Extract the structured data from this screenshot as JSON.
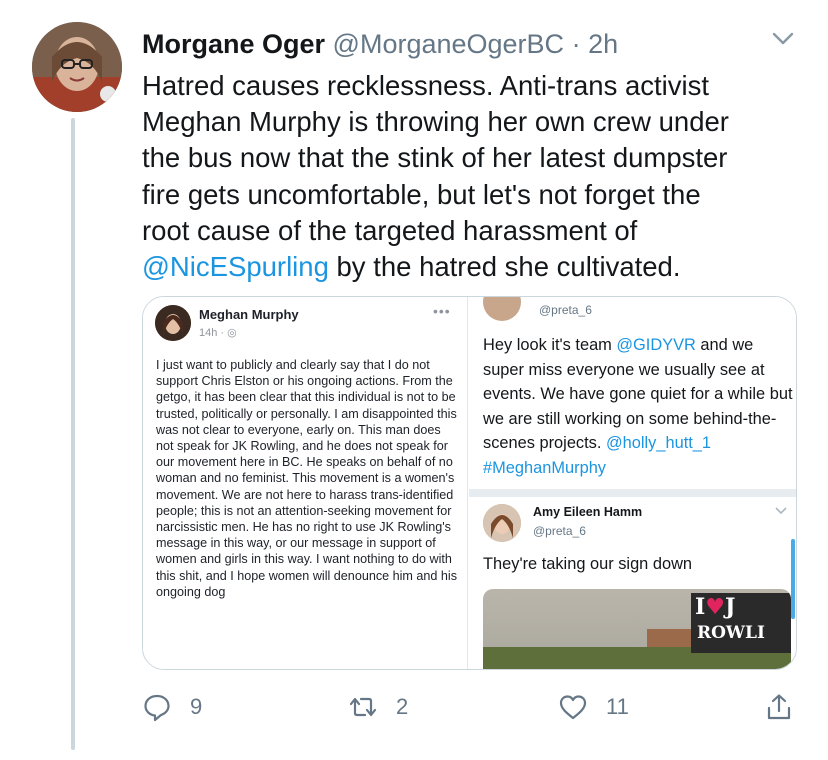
{
  "tweet": {
    "author_name": "Morgane Oger",
    "author_handle": "@MorganeOgerBC",
    "separator": "·",
    "time": "2h",
    "text_lines": [
      "Hatred causes recklessness. Anti-trans activist",
      "Meghan Murphy is throwing her own crew under",
      "the bus now that the stink of her latest dumpster",
      "fire gets uncomfortable, but let's not forget the",
      "root cause of the targeted harassment of"
    ],
    "mention": "@NicESpurling",
    "text_end": " by the hatred she cultivated."
  },
  "facebook_post": {
    "name": "Meghan Murphy",
    "meta": "14h · ",
    "more": "•••",
    "body": "I just want to publicly and clearly say that I do not support Chris Elston or his ongoing actions. From the getgo, it has been clear that this individual is not to be trusted, politically or personally. I am disappointed this was not clear to everyone, early on. This man does not speak for JK Rowling, and he does not speak for our movement here in BC. He speaks on behalf of no woman and no feminist. This movement is a women's movement. We are not here to harass trans-identified people; this is not an attention-seeking movement for narcissistic men. He has no right to use JK Rowling's message in this way, or our message in support of women and girls in this way. I want nothing to do with this shit, and I hope women will denounce him and his ongoing dog"
  },
  "embedded_tweets": {
    "first": {
      "handle": "@preta_6",
      "text_a": "Hey look it's team ",
      "link_a": "@GIDYVR",
      "text_b": " and we super miss everyone we usually see at events. We have gone quiet for a while but we are still working on some  behind-the-scenes projects. ",
      "link_b": "@holly_hutt_1 #MeghanMurphy"
    },
    "second": {
      "name": "Amy Eileen Hamm",
      "handle": "@preta_6",
      "text": "They're taking our sign down",
      "billboard_line1_a": "I",
      "billboard_heart": "♥",
      "billboard_line1_b": "J",
      "billboard_line2": "ROWLI"
    }
  },
  "actions": {
    "reply_count": "9",
    "retweet_count": "2",
    "like_count": "11"
  },
  "colors": {
    "link": "#1b95e0",
    "muted": "#657786",
    "border": "#ccd6dd"
  }
}
